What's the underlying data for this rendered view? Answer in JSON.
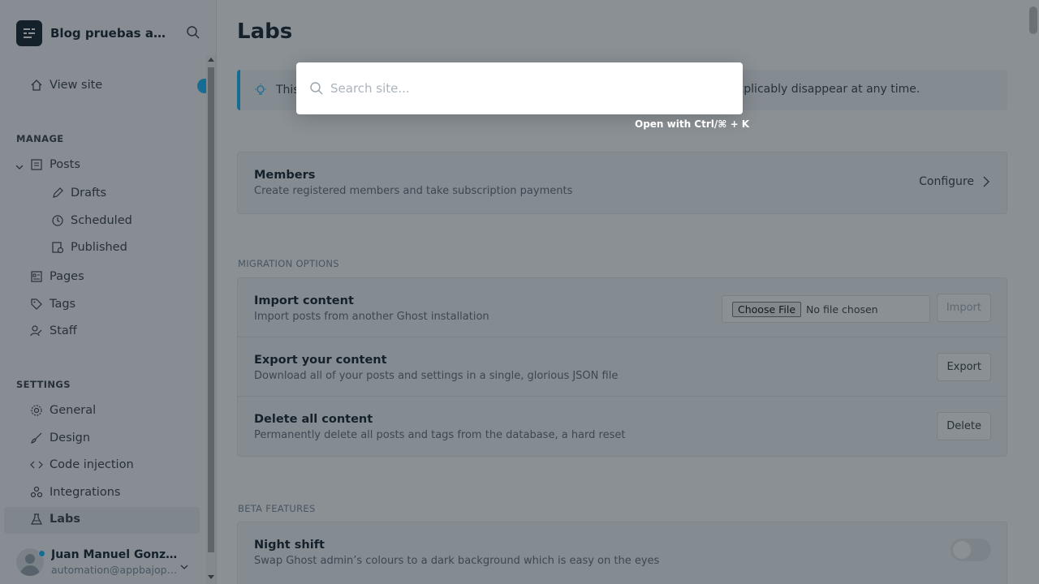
{
  "sidebar": {
    "site_title": "Blog pruebas automatizadas",
    "view_site": "View site",
    "manage_label": "MANAGE",
    "posts": "Posts",
    "drafts": "Drafts",
    "scheduled": "Scheduled",
    "published": "Published",
    "pages": "Pages",
    "tags": "Tags",
    "staff": "Staff",
    "settings_label": "SETTINGS",
    "general": "General",
    "design": "Design",
    "code_injection": "Code injection",
    "integrations": "Integrations",
    "labs": "Labs",
    "user_name": "Juan Manuel González",
    "user_email": "automation@appbajopruebas.com"
  },
  "main": {
    "title": "Labs",
    "alert_start": "This",
    "alert_end": "xplicably disappear at any time.",
    "members": {
      "title": "Members",
      "desc": "Create registered members and take subscription payments",
      "action": "Configure"
    },
    "migration_label": "MIGRATION OPTIONS",
    "import": {
      "title": "Import content",
      "desc": "Import posts from another Ghost installation",
      "file_button": "Choose File",
      "file_status": "No file chosen",
      "button": "Import"
    },
    "export": {
      "title": "Export your content",
      "desc": "Download all of your posts and settings in a single, glorious JSON file",
      "button": "Export"
    },
    "delete": {
      "title": "Delete all content",
      "desc": "Permanently delete all posts and tags from the database, a hard reset",
      "button": "Delete"
    },
    "beta_label": "BETA FEATURES",
    "night_shift": {
      "title": "Night shift",
      "desc": "Swap Ghost admin’s colours to a dark background which is easy on the eyes",
      "enabled": false
    }
  },
  "search": {
    "placeholder": "Search site...",
    "hint": "Open with Ctrl/⌘ + K"
  },
  "colors": {
    "accent": "#14b8ff",
    "text": "#15212a",
    "overlay": "rgba(21,33,42,0.5)"
  }
}
